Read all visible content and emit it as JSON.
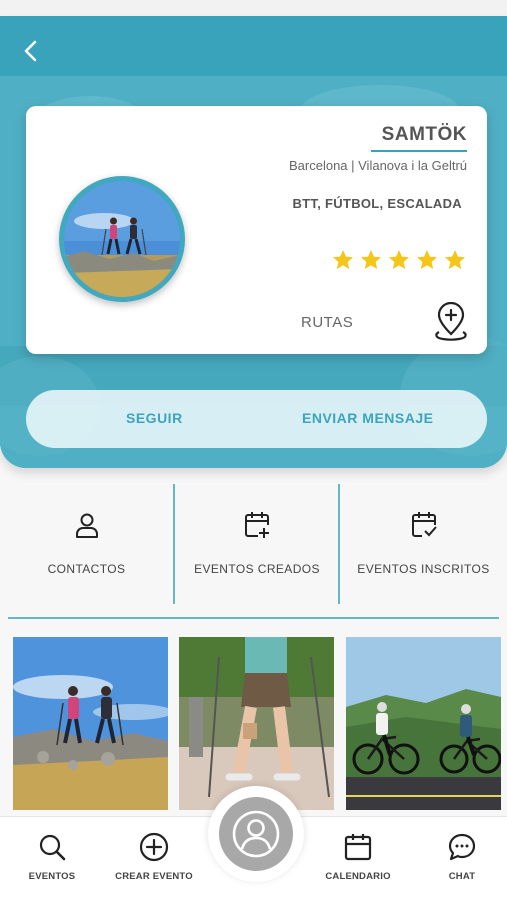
{
  "profile": {
    "name": "SAMTÖK",
    "location": "Barcelona | Vilanova i la Geltrú",
    "sports": "BTT, FÚTBOL, ESCALADA",
    "rating": 5,
    "rating_max": 5,
    "routes_label": "RUTAS"
  },
  "actions": {
    "follow_label": "SEGUIR",
    "message_label": "ENVIAR MENSAJE"
  },
  "stats": [
    {
      "label": "CONTACTOS",
      "icon": "person-icon"
    },
    {
      "label": "EVENTOS CREADOS",
      "icon": "calendar-plus-icon"
    },
    {
      "label": "EVENTOS INSCRITOS",
      "icon": "calendar-check-icon"
    }
  ],
  "gallery": [
    {
      "subject": "hikers-photo"
    },
    {
      "subject": "nordic-walking-photo"
    },
    {
      "subject": "cyclists-photo"
    }
  ],
  "nav": [
    {
      "label": "EVENTOS",
      "icon": "search-icon"
    },
    {
      "label": "CREAR EVENTO",
      "icon": "plus-circle-icon"
    },
    {
      "label": "CALENDARIO",
      "icon": "calendar-icon"
    },
    {
      "label": "CHAT",
      "icon": "chat-icon"
    }
  ],
  "colors": {
    "accent": "#3ea4bb",
    "star": "#f5c518",
    "divider": "#64b6c8",
    "fab": "#a8a8a8"
  }
}
